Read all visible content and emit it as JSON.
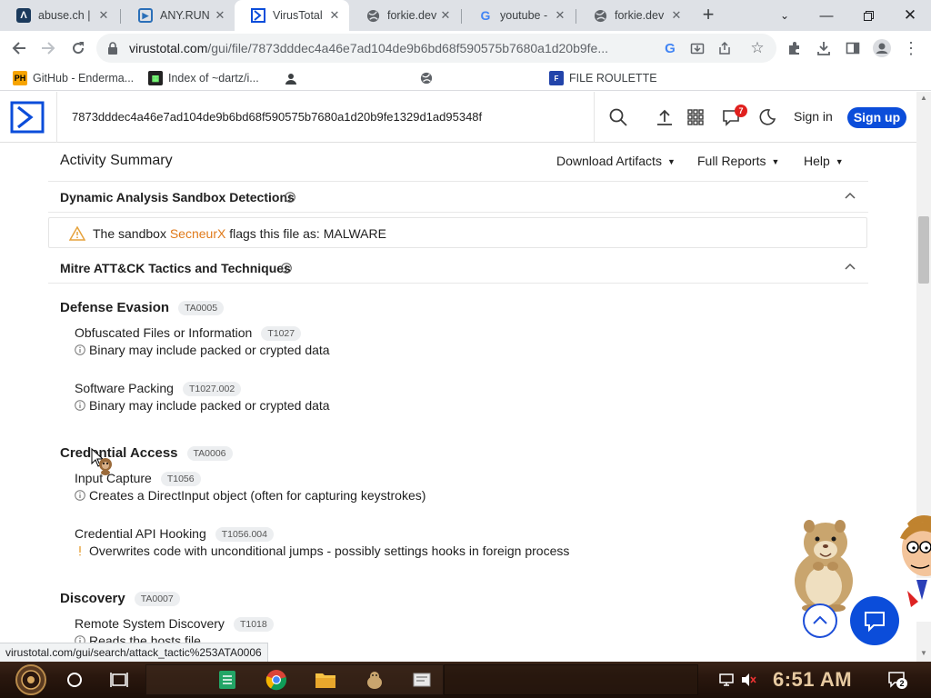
{
  "browser": {
    "tabs": [
      {
        "title": "abuse.ch |",
        "favicon": "abuse-ch-icon",
        "active": false
      },
      {
        "title": "ANY.RUN",
        "favicon": "anyrun-icon",
        "active": false
      },
      {
        "title": "VirusTotal",
        "favicon": "virustotal-icon",
        "active": true
      },
      {
        "title": "forkie.dev",
        "favicon": "globe-icon",
        "active": false
      },
      {
        "title": "youtube -",
        "favicon": "google-icon",
        "active": false
      },
      {
        "title": "forkie.dev",
        "favicon": "globe-icon",
        "active": false
      }
    ],
    "url_host": "virustotal.com",
    "url_path": "/gui/file/7873dddec4a46e7ad104de9b6bd68f590575b7680a1d20b9fe...",
    "bookmarks": [
      {
        "label": "GitHub - Enderma...",
        "icon": "ph-icon"
      },
      {
        "label": "Index of ~dartz/i...",
        "icon": "terminal-icon"
      },
      {
        "label": "",
        "icon": "user-icon"
      },
      {
        "label": "",
        "icon": "globe-icon"
      },
      {
        "label": "FILE ROULETTE",
        "icon": "file-roulette-icon"
      }
    ]
  },
  "vt": {
    "search_value": "7873dddec4a46e7ad104de9b6bd68f590575b7680a1d20b9fe1329d1ad95348f",
    "notifications_count": "7",
    "signin_label": "Sign in",
    "signup_label": "Sign up",
    "activity_title": "Activity Summary",
    "menus": [
      "Download Artifacts",
      "Full Reports",
      "Help"
    ],
    "sandbox_section_title": "Dynamic Analysis Sandbox Detections",
    "sandbox_prefix": "The sandbox ",
    "sandbox_name": "SecneurX",
    "sandbox_suffix": " flags this file as: MALWARE",
    "mitre_section_title": "Mitre ATT&CK Tactics and Techniques",
    "tactics": [
      {
        "name": "Defense Evasion",
        "id": "TA0005",
        "techniques": [
          {
            "name": "Obfuscated Files or Information",
            "id": "T1027",
            "desc": "Binary may include packed or crypted data",
            "severity": "info"
          },
          {
            "name": "Software Packing",
            "id": "T1027.002",
            "desc": "Binary may include packed or crypted data",
            "severity": "info"
          }
        ]
      },
      {
        "name": "Credential Access",
        "id": "TA0006",
        "techniques": [
          {
            "name": "Input Capture",
            "id": "T1056",
            "desc": "Creates a DirectInput object (often for capturing keystrokes)",
            "severity": "info"
          },
          {
            "name": "Credential API Hooking",
            "id": "T1056.004",
            "desc": "Overwrites code with unconditional jumps - possibly settings hooks in foreign process",
            "severity": "medium"
          }
        ]
      },
      {
        "name": "Discovery",
        "id": "TA0007",
        "techniques": [
          {
            "name": "Remote System Discovery",
            "id": "T1018",
            "desc": "Reads the hosts file",
            "severity": "info"
          }
        ]
      }
    ]
  },
  "status_bar": "virustotal.com/gui/search/attack_tactic%253ATA0006",
  "taskbar": {
    "clock": "6:51 AM",
    "notification_count": "2"
  },
  "colors": {
    "vt_blue": "#0b4dda",
    "sandbox_link": "#e07a1a",
    "warning": "#e6a23c",
    "badge_red": "#e0201e"
  }
}
